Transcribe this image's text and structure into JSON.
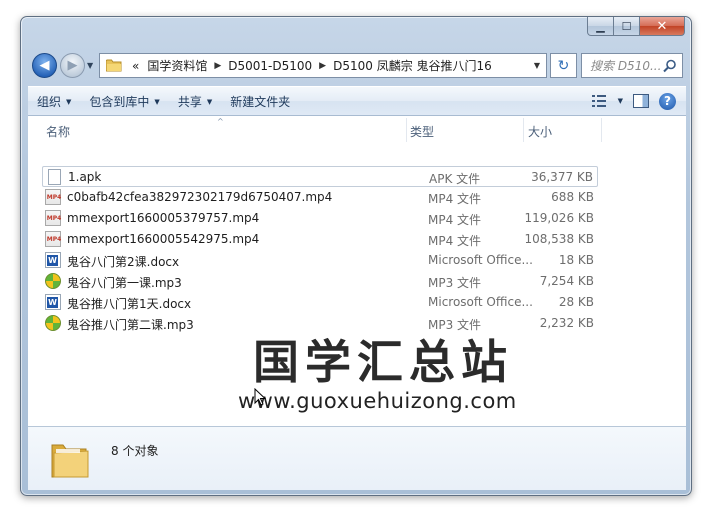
{
  "window": {
    "caption": {
      "minimize": "▁",
      "maximize": "☐",
      "close": "✕"
    }
  },
  "nav": {
    "back_glyph": "◀",
    "forward_glyph": "▶",
    "overflow": "«",
    "breadcrumbs": [
      "国学资料馆",
      "D5001-D5100",
      "D5100 凤麟宗 鬼谷推八门16"
    ],
    "search_placeholder": "搜索 D510...",
    "refresh_glyph": "↻"
  },
  "toolbar": {
    "organize": "组织",
    "include_in_library": "包含到库中",
    "share": "共享",
    "new_folder": "新建文件夹"
  },
  "columns": {
    "name": "名称",
    "type": "类型",
    "size": "大小"
  },
  "files": [
    {
      "name": "1.apk",
      "type": "APK 文件",
      "size": "36,377 KB",
      "icon": "apk-file-icon"
    },
    {
      "name": "c0bafb42cfea382972302179d6750407.mp4",
      "type": "MP4 文件",
      "size": "688 KB",
      "icon": "mp4-file-icon"
    },
    {
      "name": "mmexport1660005379757.mp4",
      "type": "MP4 文件",
      "size": "119,026 KB",
      "icon": "mp4-file-icon"
    },
    {
      "name": "mmexport1660005542975.mp4",
      "type": "MP4 文件",
      "size": "108,538 KB",
      "icon": "mp4-file-icon"
    },
    {
      "name": "鬼谷八门第2课.docx",
      "type": "Microsoft Office...",
      "size": "18 KB",
      "icon": "word-doc-icon"
    },
    {
      "name": "鬼谷八门第一课.mp3",
      "type": "MP3 文件",
      "size": "7,254 KB",
      "icon": "mp3-file-icon"
    },
    {
      "name": "鬼谷推八门第1天.docx",
      "type": "Microsoft Office...",
      "size": "28 KB",
      "icon": "word-doc-icon"
    },
    {
      "name": "鬼谷推八门第二课.mp3",
      "type": "MP3 文件",
      "size": "2,232 KB",
      "icon": "mp3-file-icon"
    }
  ],
  "watermark": {
    "title": "国学汇总站",
    "url": "www.guoxuehuizong.com"
  },
  "details": {
    "count": "8 个对象"
  },
  "colors": {
    "accent": "#2461b6",
    "close": "#c24326",
    "toolbar_text": "#1e395b"
  }
}
